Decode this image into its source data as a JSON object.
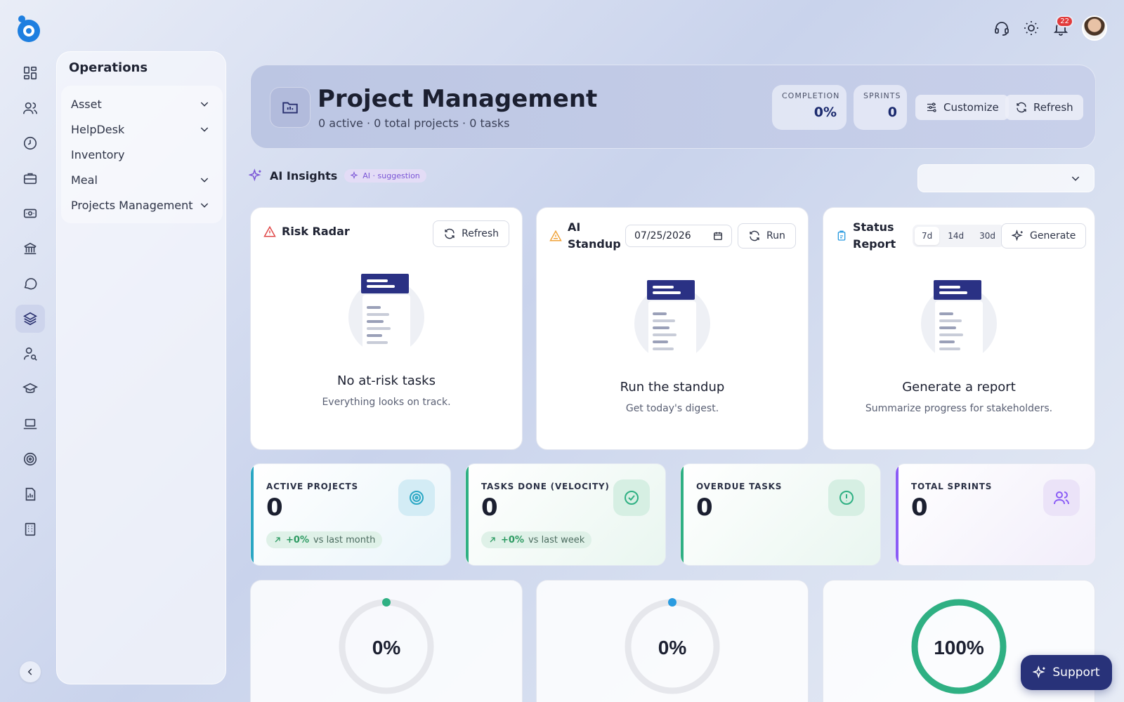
{
  "app": {
    "logo_icon": "app-logo-icon",
    "accent": "#283279"
  },
  "rail": {
    "items": [
      {
        "icon": "dashboard-icon"
      },
      {
        "icon": "users-icon"
      },
      {
        "icon": "clock-icon"
      },
      {
        "icon": "briefcase-icon"
      },
      {
        "icon": "ticket-icon"
      },
      {
        "icon": "bank-icon"
      },
      {
        "icon": "chat-icon"
      },
      {
        "icon": "layers-icon",
        "active": true
      },
      {
        "icon": "user-search-icon"
      },
      {
        "icon": "graduation-cap-icon"
      },
      {
        "icon": "laptop-icon"
      },
      {
        "icon": "target-icon"
      },
      {
        "icon": "report-icon"
      },
      {
        "icon": "building-icon"
      }
    ],
    "collapse_icon": "chevron-left-icon"
  },
  "topbar": {
    "notification_count": "22",
    "icons": [
      "headset-icon",
      "sun-icon",
      "bell-icon"
    ]
  },
  "sidebar": {
    "title": "Operations",
    "items": [
      {
        "label": "Asset",
        "expandable": true
      },
      {
        "label": "HelpDesk",
        "expandable": true
      },
      {
        "label": "Inventory",
        "expandable": false
      },
      {
        "label": "Meal",
        "expandable": true
      },
      {
        "label": "Projects Management",
        "expandable": true
      }
    ]
  },
  "header": {
    "title": "Project Management",
    "subtitle": "0 active · 0 total projects · 0 tasks",
    "completion_label": "COMPLETION",
    "completion_value": "0%",
    "sprints_label": "SPRINTS",
    "sprints_value": "0",
    "customize_label": "Customize",
    "refresh_label": "Refresh"
  },
  "ai": {
    "title": "AI Insights",
    "chip": "AI · suggestion",
    "select_value": ""
  },
  "cards": {
    "risk": {
      "title": "Risk Radar",
      "button": "Refresh",
      "empty_title": "No at-risk tasks",
      "empty_sub": "Everything looks on track."
    },
    "standup": {
      "title_line1": "AI",
      "title_line2": "Standup",
      "date": "07/25/2026",
      "button": "Run",
      "empty_title": "Run the standup",
      "empty_sub": "Get today's digest."
    },
    "status": {
      "title_line1": "Status",
      "title_line2": "Report",
      "ranges": [
        "7d",
        "14d",
        "30d"
      ],
      "selected_range": "7d",
      "button": "Generate",
      "empty_title": "Generate a report",
      "empty_sub": "Summarize progress for stakeholders."
    }
  },
  "kpis": [
    {
      "label": "ACTIVE PROJECTS",
      "value": "0",
      "trend_value": "+0%",
      "trend_text": "vs last month",
      "color": "#2aa7c4",
      "icon": "target-icon"
    },
    {
      "label": "TASKS DONE (VELOCITY)",
      "value": "0",
      "trend_value": "+0%",
      "trend_text": "vs last week",
      "color": "#2fb083",
      "icon": "check-circle-icon"
    },
    {
      "label": "OVERDUE TASKS",
      "value": "0",
      "color": "#2fb083",
      "icon": "alert-circle-icon"
    },
    {
      "label": "TOTAL SPRINTS",
      "value": "0",
      "color": "#8b5cf6",
      "icon": "users-icon"
    }
  ],
  "gauges": [
    {
      "value": "0%",
      "fraction": 0,
      "color": "#2fb083"
    },
    {
      "value": "0%",
      "fraction": 0,
      "color": "#2a9be0"
    },
    {
      "value": "100%",
      "fraction": 1,
      "color": "#2fb083"
    }
  ],
  "support": {
    "label": "Support"
  }
}
